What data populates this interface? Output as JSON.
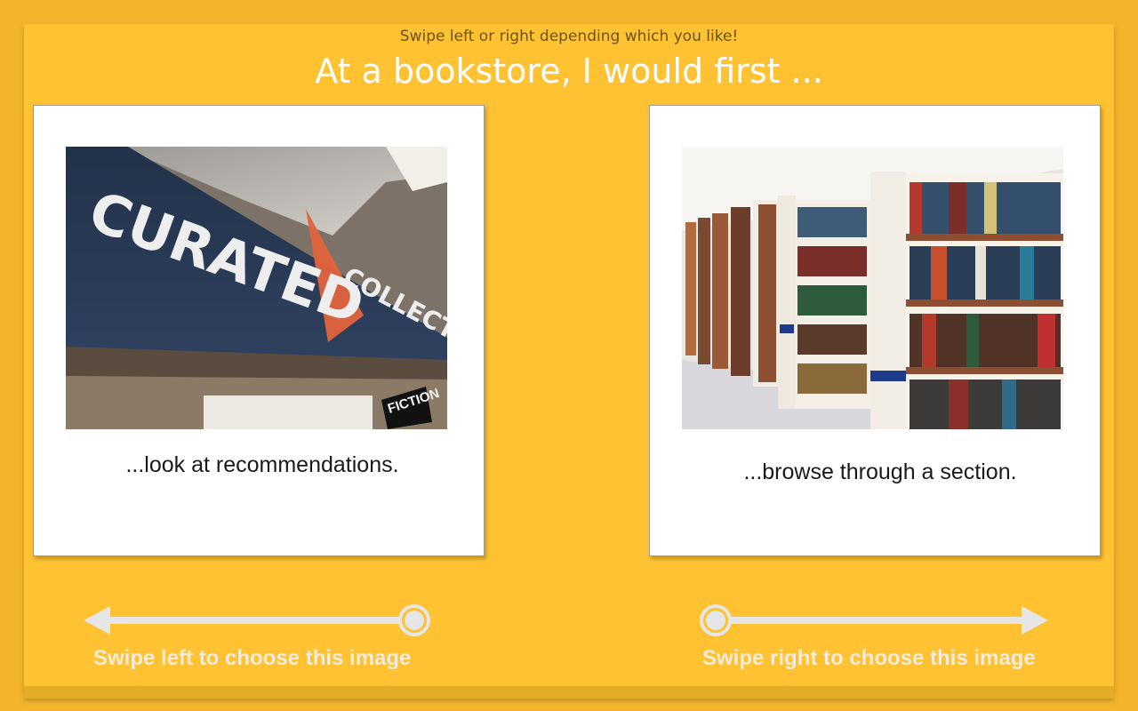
{
  "header": {
    "instruction": "Swipe left or right depending which you like!",
    "question": "At a bookstore, I would first ..."
  },
  "options": {
    "left": {
      "caption": "...look at recommendations.",
      "image_sign_text": "CURATED",
      "image_sign_text_2": "COLLECTIONS",
      "image_label_text": "FICTION",
      "swipe_label": "Swipe left to choose this image"
    },
    "right": {
      "caption": "...browse through a section.",
      "swipe_label": "Swipe right to choose this image"
    }
  },
  "colors": {
    "background": "#F2B52C",
    "panel": "#FFC233",
    "title_text": "#ffffff",
    "swipe_hint": "#F3ECDC"
  },
  "icons": {
    "left": "left-swipe-arrow-icon",
    "right": "right-swipe-arrow-icon"
  }
}
